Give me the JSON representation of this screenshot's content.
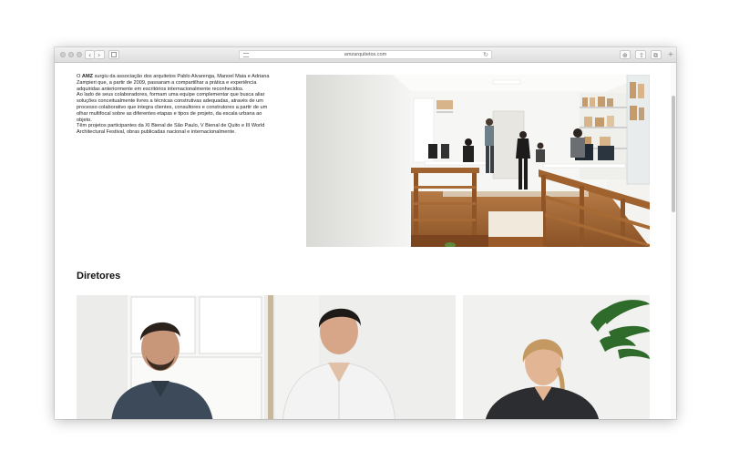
{
  "browser": {
    "url": "amzarquitetos.com"
  },
  "intro": {
    "p1_prefix": "O ",
    "p1_brand": "AMZ",
    "p1_rest": " surgiu da associação dos arquitetos Pablo Alvarenga, Manoel Maia e Adriana Zampieri que, a partir de 2009, passaram a compartilhar a prática e experiência adquiridas anteriormente em escritórios internacionalmente reconhecidos.",
    "p2": "Ao lado de seus colaboradores, formam uma equipe complementar que busca aliar soluções conceitualmente livres a técnicas construtivas adequadas, através de um processo colaborativo que integra clientes, consultores e construtores a partir de um olhar multifocal sobre as diferentes etapas e tipos de projeto, da escala urbana ao objeto.",
    "p3": "Têm projetos participantes da XI Bienal de São Paulo, V Bienal de Quito e III World Architectural Festival, obras publicadas nacional e internacionalmente."
  },
  "section": {
    "title": "Diretores"
  },
  "colors": {
    "page_background": "#ffffff",
    "text": "#222222",
    "wood": "#a0622e",
    "toolbar": "#e6e6e6"
  },
  "icons": [
    "back-icon",
    "forward-icon",
    "sidebar-icon",
    "reader-icon",
    "reload-icon",
    "download-icon",
    "share-icon",
    "tabs-icon",
    "new-tab-icon"
  ]
}
